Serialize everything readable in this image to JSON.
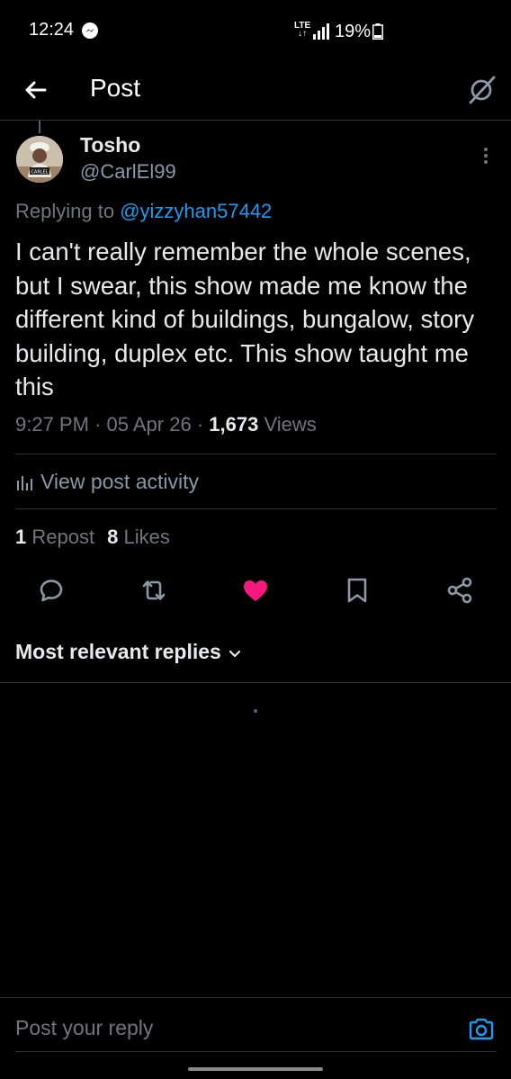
{
  "status_bar": {
    "time": "12:24",
    "network": "LTE",
    "battery": "19%",
    "icons": [
      "messenger-icon",
      "signal-icon",
      "battery-icon"
    ]
  },
  "header": {
    "title": "Post",
    "back_icon": "arrow-left-icon",
    "right_icon": "grok-icon"
  },
  "post": {
    "author_name": "Tosho",
    "author_handle": "@CarlEl99",
    "avatar_label": "CARLEL",
    "replying_prefix": "Replying to ",
    "replying_to": "@yizzyhan57442",
    "text": "I can't really remember the whole scenes, but I swear, this show made me know the different kind of buildings, bungalow, story building, duplex etc. This show taught me this",
    "time": "9:27 PM",
    "date": "05 Apr 26",
    "separator": "·",
    "views_count": "1,673",
    "views_label": "Views"
  },
  "activity": {
    "label": "View post activity"
  },
  "stats": {
    "reposts_count": "1",
    "reposts_label": "Repost",
    "likes_count": "8",
    "likes_label": "Likes"
  },
  "actions": {
    "icons": [
      "reply-icon",
      "repost-icon",
      "like-icon",
      "bookmark-icon",
      "share-icon"
    ],
    "like_color": "#f91880",
    "liked": true
  },
  "replies": {
    "sort_label": "Most relevant replies"
  },
  "composer": {
    "placeholder": "Post your reply"
  },
  "colors": {
    "background": "#000000",
    "text": "#e7e9ea",
    "secondary": "#71767b",
    "accent": "#1d9bf0",
    "divider": "#2f3336"
  }
}
